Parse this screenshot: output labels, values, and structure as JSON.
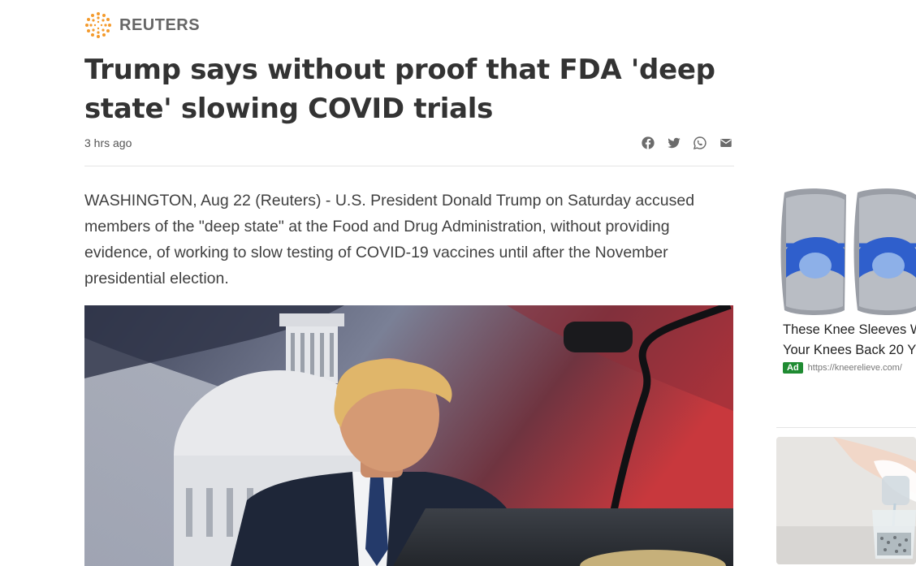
{
  "header": {
    "logo_icon": "reuters-dot-logo",
    "brand_name": "REUTERS"
  },
  "article": {
    "headline": "Trump says without proof that FDA 'deep state' slowing COVID trials",
    "timestamp": "3 hrs ago",
    "lead": "WASHINGTON, Aug 22 (Reuters) - U.S. President Donald Trump on Saturday accused members of the \"deep state\" at the Food and Drug Administration, without providing evidence, of working to slow testing of COVID-19 vaccines until after the November presidential election."
  },
  "share": {
    "icons": [
      "facebook-icon",
      "twitter-icon",
      "whatsapp-icon",
      "mail-icon"
    ]
  },
  "sidebar": {
    "ad1": {
      "title_line1": "These Knee Sleeves W",
      "title_line2": "Your Knees Back 20 Y",
      "badge": "Ad",
      "url": "https://kneerelieve.com/"
    }
  },
  "colors": {
    "logo_orange": "#f49a2c",
    "text_dark": "#333333",
    "text_meta": "#555555",
    "icon_gray": "#6b6b6b",
    "ad_badge_green": "#1f8b32"
  }
}
